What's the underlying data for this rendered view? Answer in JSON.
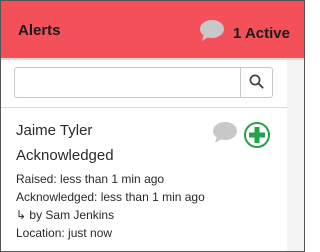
{
  "header": {
    "title": "Alerts",
    "active_count_label": "1 Active",
    "icon": "speech-bubble-icon"
  },
  "search": {
    "value": "",
    "placeholder": "",
    "icon": "search-icon"
  },
  "alerts": [
    {
      "name": "Jaime Tyler",
      "status": "Acknowledged",
      "raised": "Raised: less than 1 min ago",
      "acknowledged": "Acknowledged: less than 1 min ago",
      "by": "↳ by Sam Jenkins",
      "location": "Location: just now",
      "icons": [
        "speech-bubble-icon",
        "medical-cross-icon"
      ]
    }
  ],
  "colors": {
    "header_bg": "#f4505a",
    "icon_gray": "#c8c8c8",
    "cross_green": "#22a34a"
  }
}
